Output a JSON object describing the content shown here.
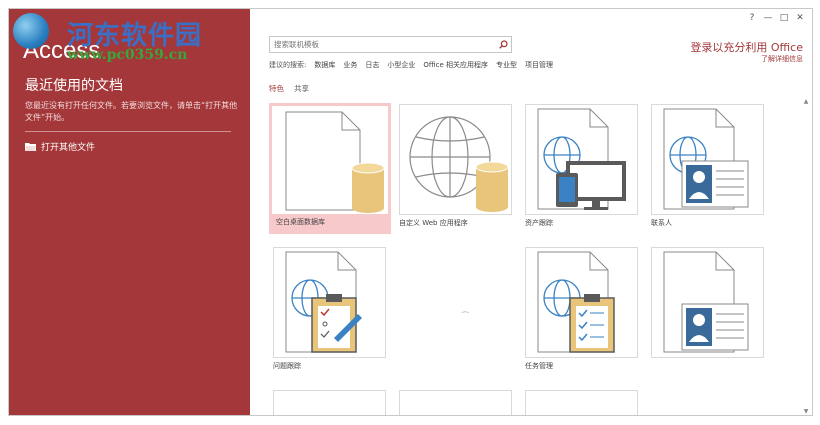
{
  "watermark": {
    "title": "河东软件园",
    "url": "www.pc0359.cn"
  },
  "app": {
    "name": "Access"
  },
  "left": {
    "recent_title": "最近使用的文档",
    "recent_desc": "您最近没有打开任何文件。若要浏览文件，请单击“打开其他文件”开始。",
    "open_other": "打开其他文件"
  },
  "window_controls": {
    "help": "?",
    "minimize": "—",
    "restore": "□",
    "close": "✕"
  },
  "search": {
    "placeholder": "搜索联机模板"
  },
  "suggested": {
    "label": "建议的搜索:",
    "items": [
      "数据库",
      "业务",
      "日志",
      "小型企业",
      "Office 相关应用程序",
      "专业型",
      "项目管理"
    ]
  },
  "tabs": [
    {
      "label": "特色"
    },
    {
      "label": "共享"
    }
  ],
  "signin": {
    "text": "登录以充分利用 Office",
    "learn_more": "了解详细信息"
  },
  "templates": [
    {
      "label": "空白桌面数据库"
    },
    {
      "label": "自定义 Web 应用程序"
    },
    {
      "label": "资产跟踪"
    },
    {
      "label": "联系人"
    },
    {
      "label": "问题跟踪"
    },
    {
      "label": "任务管理"
    },
    {
      "label": ""
    }
  ],
  "colors": {
    "accent": "#a4373a",
    "db_gold": "#e8c57a",
    "globe_blue": "#3a82c4"
  }
}
